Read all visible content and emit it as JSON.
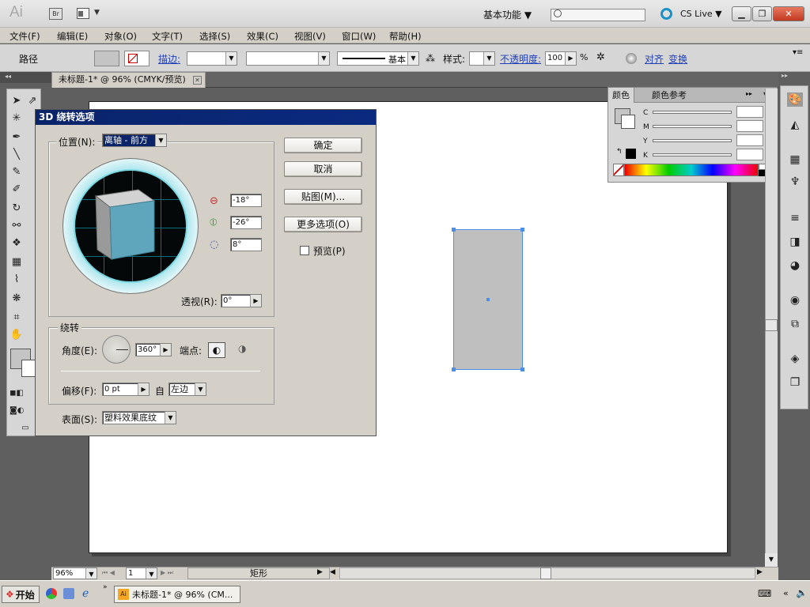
{
  "app": {
    "logo": "Ai",
    "bridge": "Br",
    "workspace": "基本功能 ▼",
    "cslive": "CS Live ▼"
  },
  "menu": [
    "文件(F)",
    "编辑(E)",
    "对象(O)",
    "文字(T)",
    "选择(S)",
    "效果(C)",
    "视图(V)",
    "窗口(W)",
    "帮助(H)"
  ],
  "controlbar": {
    "selection": "路径",
    "stroke_label": "描边:",
    "stroke_style": "基本",
    "style_label": "样式:",
    "opacity_label": "不透明度:",
    "opacity_value": "100",
    "opacity_unit": "%",
    "align_link": "对齐",
    "transform_link": "变换"
  },
  "document": {
    "tab": "未标题-1* @ 96% (CMYK/预览)",
    "shape": "矩形"
  },
  "status": {
    "zoom": "96%",
    "page": "1",
    "shape_name": "矩形"
  },
  "colorpanel": {
    "tab_color": "颜色",
    "tab_guide": "颜色参考",
    "labels": [
      "C",
      "M",
      "Y",
      "K"
    ],
    "pct": [
      "%",
      "%",
      "%",
      "%"
    ]
  },
  "dialog": {
    "title": "3D 绕转选项",
    "position_label": "位置(N):",
    "position_value": "离轴 - 前方",
    "rot_x": "-18°",
    "rot_y": "-26°",
    "rot_z": "8°",
    "perspective_label": "透视(R):",
    "perspective_value": "0°",
    "revolve_label": "绕转",
    "angle_label": "角度(E):",
    "angle_value": "360°",
    "cap_label": "端点:",
    "offset_label": "偏移(F):",
    "offset_value": "0 pt",
    "from_label": "自",
    "from_value": "左边",
    "surface_label": "表面(S):",
    "surface_value": "塑料效果底纹",
    "ok": "确定",
    "cancel": "取消",
    "map_art": "贴图(M)...",
    "more_options": "更多选项(O)",
    "preview": "预览(P)"
  },
  "taskbar": {
    "start": "开始",
    "task": "未标题-1* @ 96% (CM..."
  },
  "colors": {
    "accent": "#0a246a",
    "selection": "#4d8fe6",
    "cube_front": "#5fa6bd",
    "cube_top": "#d2d2d2",
    "cube_side": "#9a9a9a"
  }
}
